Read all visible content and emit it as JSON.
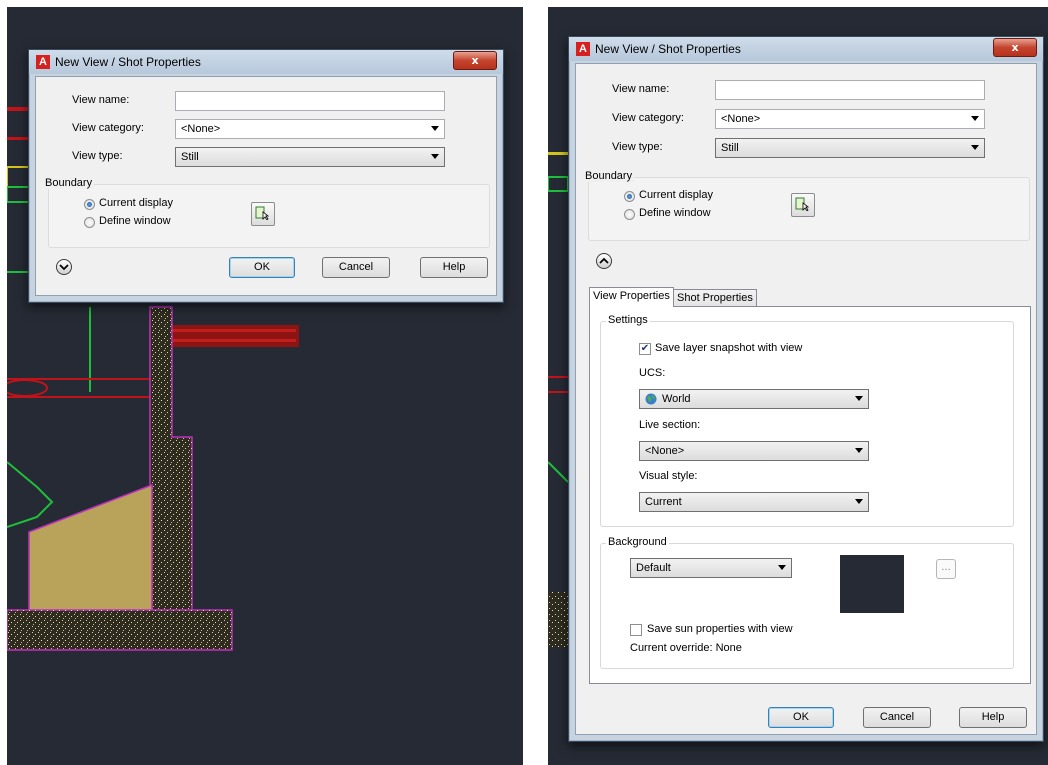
{
  "dialog": {
    "title": "New View / Shot Properties",
    "close_label": "x",
    "app_icon_letter": "A",
    "view_name_label": "View name:",
    "view_name_value": "",
    "view_category_label": "View category:",
    "view_category_value": "<None>",
    "view_type_label": "View type:",
    "view_type_value": "Still",
    "boundary": {
      "title": "Boundary",
      "current_display": "Current display",
      "define_window": "Define window",
      "selected": "Current display"
    },
    "buttons": {
      "ok": "OK",
      "cancel": "Cancel",
      "help": "Help"
    }
  },
  "expanded": {
    "tabs": [
      "View Properties",
      "Shot Properties"
    ],
    "active_tab": "View Properties",
    "settings": {
      "title": "Settings",
      "save_layer_snapshot": "Save layer snapshot with view",
      "save_layer_snapshot_checked": true,
      "ucs_label": "UCS:",
      "ucs_value": "World",
      "live_section_label": "Live section:",
      "live_section_value": "<None>",
      "visual_style_label": "Visual style:",
      "visual_style_value": "Current"
    },
    "background": {
      "title": "Background",
      "value": "Default",
      "swatch_color": "#252a34",
      "ellipsis": "...",
      "save_sun": "Save sun properties with view",
      "save_sun_checked": false,
      "current_override": "Current override: None"
    }
  },
  "colors": {
    "cad_background": "#252a34",
    "close_button": "#c4442e",
    "dialog_frame": "#c8d3e0"
  }
}
